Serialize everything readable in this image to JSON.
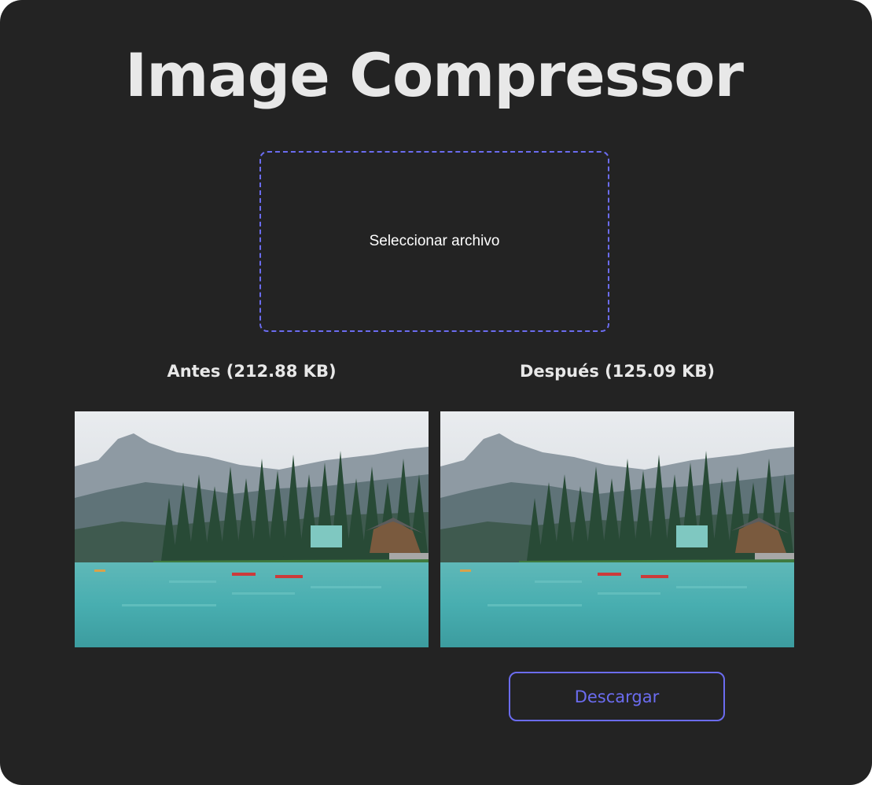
{
  "app": {
    "title": "Image Compressor"
  },
  "upload": {
    "label": "Seleccionar archivo"
  },
  "comparison": {
    "before_label": "Antes (212.88 KB)",
    "after_label": "Después (125.09 KB)"
  },
  "actions": {
    "download_label": "Descargar"
  },
  "colors": {
    "background": "#232323",
    "accent": "#6b6cf0",
    "text": "#e8e8e8"
  }
}
